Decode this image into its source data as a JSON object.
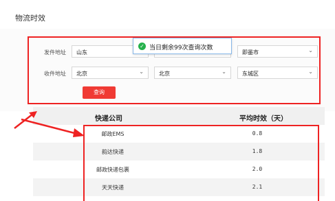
{
  "header": {
    "title": "物流时效"
  },
  "form": {
    "sender_label": "发件地址",
    "receiver_label": "收件地址",
    "sender_province": "山东",
    "sender_city": "",
    "sender_district": "即墨市",
    "receiver_province": "北京",
    "receiver_city": "北京",
    "receiver_district": "东城区",
    "query_button": "查询"
  },
  "toast": {
    "message": "当日剩余99次查询次数",
    "icon": "check-circle-icon"
  },
  "table": {
    "headers": [
      "快递公司",
      "平均时效（天）"
    ],
    "rows": [
      {
        "company": "邮政EMS",
        "avg": "0.8"
      },
      {
        "company": "韵达快递",
        "avg": "1.8"
      },
      {
        "company": "邮政快递包裹",
        "avg": "2.0"
      },
      {
        "company": "天天快递",
        "avg": "2.1"
      }
    ]
  },
  "colors": {
    "highlight": "#e22222",
    "primary_button": "#f03a34",
    "success": "#25b14c"
  }
}
